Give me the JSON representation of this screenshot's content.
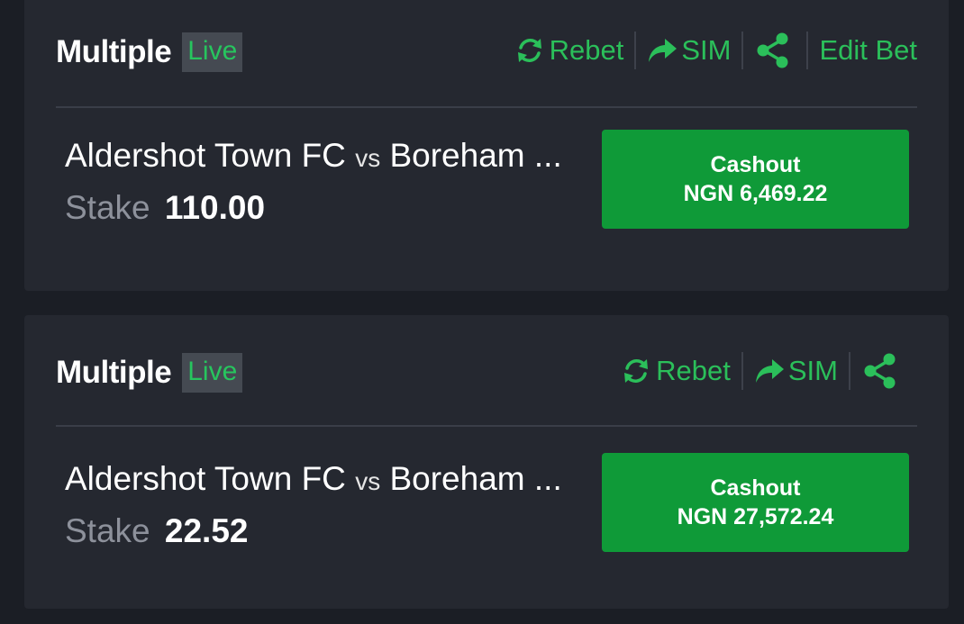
{
  "colors": {
    "accent_green": "#2bbf5a",
    "cashout_bg": "#0f9a38",
    "card_bg": "#252830",
    "page_bg": "#1b1e25"
  },
  "bets": [
    {
      "title": "Multiple",
      "status": "Live",
      "actions": {
        "rebet": "Rebet",
        "sim": "SIM",
        "share_icon": "share-icon",
        "edit": "Edit Bet"
      },
      "home_team": "Aldershot Town FC",
      "vs": "vs",
      "away_team": "Boreham ...",
      "stake_label": "Stake",
      "stake_value": "110.00",
      "cashout_label": "Cashout",
      "cashout_amount": "NGN 6,469.22"
    },
    {
      "title": "Multiple",
      "status": "Live",
      "actions": {
        "rebet": "Rebet",
        "sim": "SIM",
        "share_icon": "share-icon"
      },
      "home_team": "Aldershot Town FC",
      "vs": "vs",
      "away_team": "Boreham ...",
      "stake_label": "Stake",
      "stake_value": "22.52",
      "cashout_label": "Cashout",
      "cashout_amount": "NGN 27,572.24"
    }
  ]
}
